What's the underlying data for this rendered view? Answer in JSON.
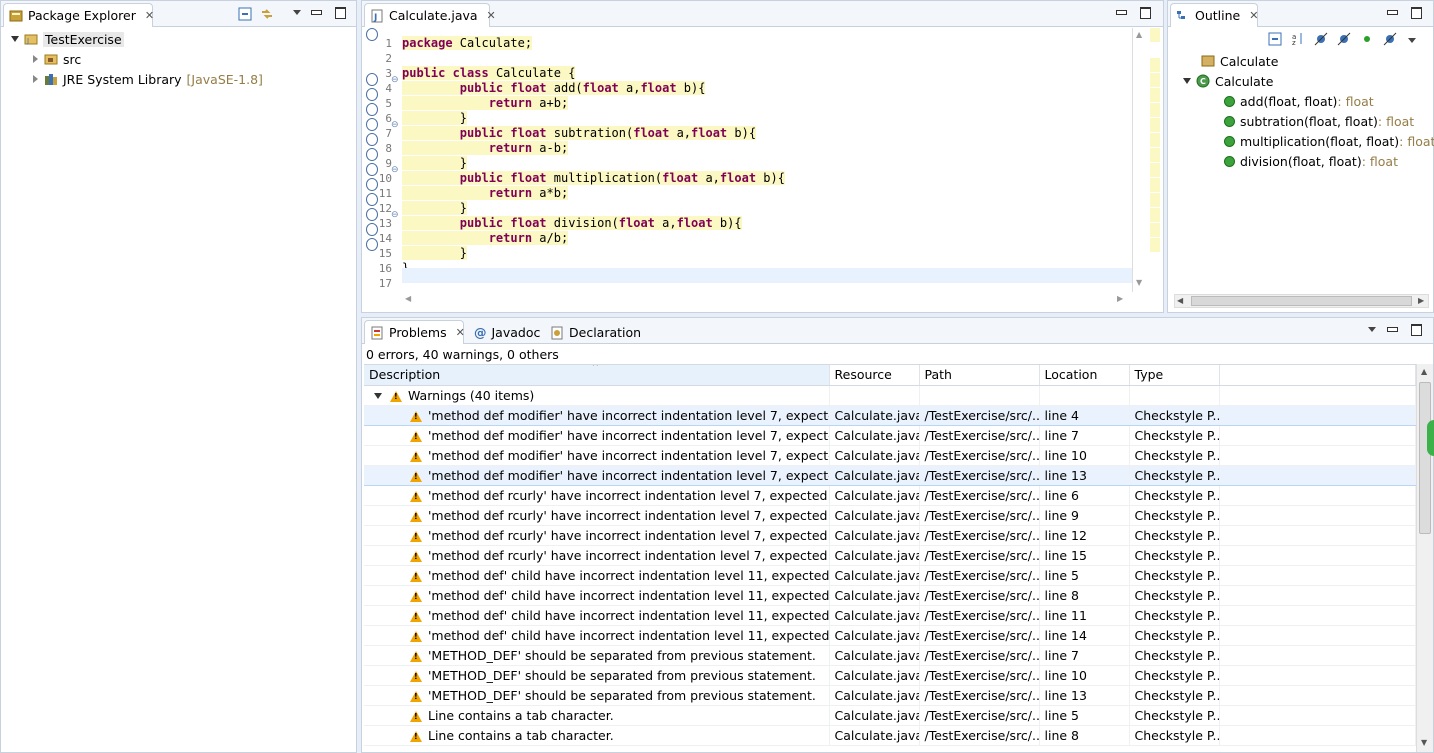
{
  "package_explorer": {
    "title": "Package Explorer",
    "tree": [
      {
        "label": "TestExercise",
        "level": 0,
        "expanded": true
      },
      {
        "label": "src",
        "level": 1,
        "expanded": false
      },
      {
        "label": "JRE System Library",
        "suffix": "[JavaSE-1.8]",
        "level": 1,
        "expanded": false
      }
    ]
  },
  "editor": {
    "tab_title": "Calculate.java",
    "lines": [
      {
        "n": "1",
        "code": "package Calculate;"
      },
      {
        "n": "2",
        "code": ""
      },
      {
        "n": "3",
        "code": "public class Calculate {"
      },
      {
        "n": "4",
        "code": "        public float add(float a,float b){"
      },
      {
        "n": "5",
        "code": "            return a+b;"
      },
      {
        "n": "6",
        "code": "        }"
      },
      {
        "n": "7",
        "code": "        public float subtration(float a,float b){"
      },
      {
        "n": "8",
        "code": "            return a-b;"
      },
      {
        "n": "9",
        "code": "        }"
      },
      {
        "n": "10",
        "code": "        public float multiplication(float a,float b){"
      },
      {
        "n": "11",
        "code": "            return a*b;"
      },
      {
        "n": "12",
        "code": "        }"
      },
      {
        "n": "13",
        "code": "        public float division(float a,float b){"
      },
      {
        "n": "14",
        "code": "            return a/b;"
      },
      {
        "n": "15",
        "code": "        }"
      },
      {
        "n": "16",
        "code": "}"
      },
      {
        "n": "17",
        "code": ""
      }
    ]
  },
  "outline": {
    "title": "Outline",
    "package": "Calculate",
    "class": "Calculate",
    "methods": [
      {
        "name": "add(float, float)",
        "type": " : float"
      },
      {
        "name": "subtration(float, float)",
        "type": " : float"
      },
      {
        "name": "multiplication(float, float)",
        "type": " : float"
      },
      {
        "name": "division(float, float)",
        "type": " : float"
      }
    ]
  },
  "bottom_tabs": {
    "problems": "Problems",
    "javadoc": "Javadoc",
    "declaration": "Declaration"
  },
  "problems": {
    "summary": "0 errors, 40 warnings, 0 others",
    "columns": [
      "Description",
      "Resource",
      "Path",
      "Location",
      "Type"
    ],
    "group_label": "Warnings (40 items)",
    "rows": [
      [
        "'method def modifier' have incorrect indentation level 7, expected level",
        "Calculate.java",
        "/TestExercise/src/...",
        "line 4",
        "Checkstyle P..."
      ],
      [
        "'method def modifier' have incorrect indentation level 7, expected level",
        "Calculate.java",
        "/TestExercise/src/...",
        "line 7",
        "Checkstyle P..."
      ],
      [
        "'method def modifier' have incorrect indentation level 7, expected level",
        "Calculate.java",
        "/TestExercise/src/...",
        "line 10",
        "Checkstyle P..."
      ],
      [
        "'method def modifier' have incorrect indentation level 7, expected level",
        "Calculate.java",
        "/TestExercise/src/...",
        "line 13",
        "Checkstyle P..."
      ],
      [
        "'method def rcurly' have incorrect indentation level 7, expected level",
        "Calculate.java",
        "/TestExercise/src/...",
        "line 6",
        "Checkstyle P..."
      ],
      [
        "'method def rcurly' have incorrect indentation level 7, expected level",
        "Calculate.java",
        "/TestExercise/src/...",
        "line 9",
        "Checkstyle P..."
      ],
      [
        "'method def rcurly' have incorrect indentation level 7, expected level",
        "Calculate.java",
        "/TestExercise/src/...",
        "line 12",
        "Checkstyle P..."
      ],
      [
        "'method def rcurly' have incorrect indentation level 7, expected level",
        "Calculate.java",
        "/TestExercise/src/...",
        "line 15",
        "Checkstyle P..."
      ],
      [
        "'method def' child have incorrect indentation level 11, expected level",
        "Calculate.java",
        "/TestExercise/src/...",
        "line 5",
        "Checkstyle P..."
      ],
      [
        "'method def' child have incorrect indentation level 11, expected level",
        "Calculate.java",
        "/TestExercise/src/...",
        "line 8",
        "Checkstyle P..."
      ],
      [
        "'method def' child have incorrect indentation level 11, expected level",
        "Calculate.java",
        "/TestExercise/src/...",
        "line 11",
        "Checkstyle P..."
      ],
      [
        "'method def' child have incorrect indentation level 11, expected level",
        "Calculate.java",
        "/TestExercise/src/...",
        "line 14",
        "Checkstyle P..."
      ],
      [
        "'METHOD_DEF' should be separated from previous statement.",
        "Calculate.java",
        "/TestExercise/src/...",
        "line 7",
        "Checkstyle P..."
      ],
      [
        "'METHOD_DEF' should be separated from previous statement.",
        "Calculate.java",
        "/TestExercise/src/...",
        "line 10",
        "Checkstyle P..."
      ],
      [
        "'METHOD_DEF' should be separated from previous statement.",
        "Calculate.java",
        "/TestExercise/src/...",
        "line 13",
        "Checkstyle P..."
      ],
      [
        "Line contains a tab character.",
        "Calculate.java",
        "/TestExercise/src/...",
        "line 5",
        "Checkstyle P..."
      ],
      [
        "Line contains a tab character.",
        "Calculate.java",
        "/TestExercise/src/...",
        "line 8",
        "Checkstyle P..."
      ]
    ]
  },
  "colors": {
    "keyword": "#7f0055",
    "highlight": "#fbf8c3",
    "warning": "#f0a400",
    "selection": "#eaf3fd"
  }
}
